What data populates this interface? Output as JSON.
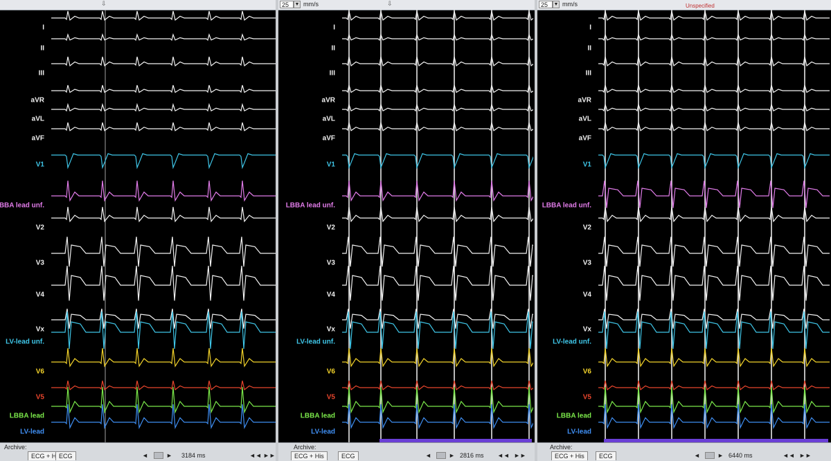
{
  "app": {
    "speed_value": "25",
    "speed_unit": "mm/s",
    "archive_label": "Archive:",
    "scroll_left": "◄",
    "scroll_right": "►",
    "skip_back": "◄◄",
    "skip_fwd": "►►"
  },
  "panels": [
    {
      "tabs": [
        "ECG + His",
        "ECG"
      ],
      "duration": "3184 ms",
      "unspecified": "",
      "labels": [
        "I",
        "II",
        "III",
        "aVR",
        "aVL",
        "aVF",
        "V1",
        "BBA lead unf.",
        "V2",
        "V3",
        "V4",
        "Vx",
        "LV-lead unf.",
        "V6",
        "V5",
        "LBBA lead",
        "LV-lead"
      ]
    },
    {
      "tabs": [
        "ECG + His",
        "ECG"
      ],
      "duration": "2816 ms",
      "unspecified": "",
      "labels": [
        "I",
        "II",
        "III",
        "aVR",
        "aVL",
        "aVF",
        "V1",
        "LBBA lead unf.",
        "V2",
        "V3",
        "V4",
        "Vx",
        "LV-lead unf.",
        "V6",
        "V5",
        "LBBA lead",
        "LV-lead"
      ]
    },
    {
      "tabs": [
        "ECG + His",
        "ECG"
      ],
      "duration": "6440 ms",
      "unspecified": "Unspecified",
      "labels": [
        "I",
        "II",
        "III",
        "aVR",
        "aVL",
        "aVF",
        "V1",
        "LBBA lead unf.",
        "V2",
        "V3",
        "V4",
        "Vx",
        "LV-lead unf.",
        "V6",
        "V5",
        "LBBA lead",
        "LV-lead"
      ]
    }
  ],
  "colors": {
    "white": "#f2f2f2",
    "cyan": "#3fc6e8",
    "magenta": "#e07be8",
    "yellow": "#f2d22a",
    "red": "#e8452c",
    "green": "#7be84a",
    "blue": "#3f8ef2",
    "label_white": "#f0f0f0"
  }
}
